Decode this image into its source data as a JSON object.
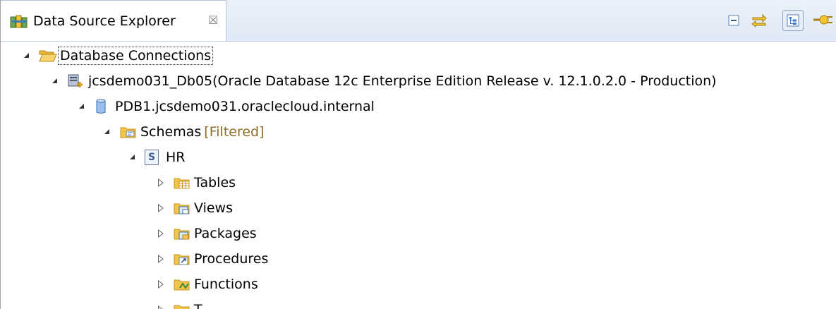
{
  "view": {
    "title": "Data Source Explorer",
    "close_glyph": "☒",
    "toolbar": [
      {
        "name": "collapse-all-button",
        "icon": "collapse-all-icon"
      },
      {
        "name": "link-with-editor-button",
        "icon": "link-with-editor-icon"
      },
      {
        "name": "show-hierarchy-button",
        "icon": "hierarchy-icon",
        "pressed": true
      },
      {
        "name": "new-connection-profile-button",
        "icon": "new-connection-icon"
      }
    ]
  },
  "tree": {
    "root": {
      "label": "Database Connections",
      "expanded": true,
      "icon": "open-folder-icon"
    },
    "connection": {
      "label": "jcsdemo031_Db05(Oracle Database 12c Enterprise Edition Release v. 12.1.0.2.0 - Production)",
      "expanded": true,
      "icon": "database-connection-icon"
    },
    "database": {
      "label": "PDB1.jcsdemo031.oraclecloud.internal",
      "expanded": true,
      "icon": "database-icon"
    },
    "schemas": {
      "label": "Schemas",
      "decoration": "[Filtered]",
      "expanded": true,
      "icon": "schemas-folder-icon"
    },
    "schema": {
      "label": "HR",
      "icon_text": "S",
      "expanded": true,
      "icon": "schema-icon"
    },
    "children": [
      {
        "label": "Tables",
        "icon": "tables-folder-icon"
      },
      {
        "label": "Views",
        "icon": "views-folder-icon"
      },
      {
        "label": "Packages",
        "icon": "packages-folder-icon"
      },
      {
        "label": "Procedures",
        "icon": "procedures-folder-icon"
      },
      {
        "label": "Functions",
        "icon": "functions-folder-icon"
      },
      {
        "label": "T",
        "icon": "folder-icon"
      }
    ]
  },
  "colors": {
    "folder": "#f0c54a",
    "folder_dark": "#c9951f",
    "accent": "#3c78c8",
    "decoration": "#8c6e2a"
  }
}
